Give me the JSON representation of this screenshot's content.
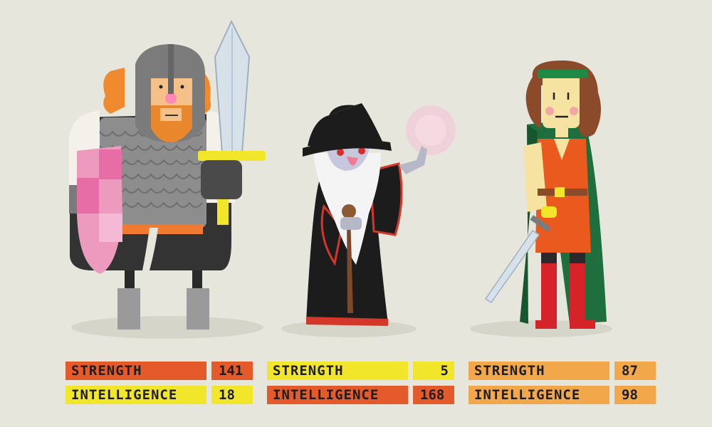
{
  "characters": [
    {
      "name": "",
      "stats": [
        {
          "label": "STRENGTH",
          "value": "141",
          "color": "#e55a2a"
        },
        {
          "label": "INTELLIGENCE",
          "value": "18",
          "color": "#f2e62a"
        }
      ]
    },
    {
      "name": "",
      "stats": [
        {
          "label": "STRENGTH",
          "value": "5",
          "color": "#f2e62a"
        },
        {
          "label": "INTELLIGENCE",
          "value": "168",
          "color": "#e55a2a"
        }
      ]
    },
    {
      "name": "",
      "stats": [
        {
          "label": "STRENGTH",
          "value": "87",
          "color": "#f2a84a"
        },
        {
          "label": "INTELLIGENCE",
          "value": "98",
          "color": "#f2a84a"
        }
      ]
    }
  ],
  "colors": {
    "background": "#e7e6dc",
    "orange_bar": "#e55a2a",
    "yellow_bar": "#f2e62a",
    "light_orange_bar": "#f2a84a"
  }
}
